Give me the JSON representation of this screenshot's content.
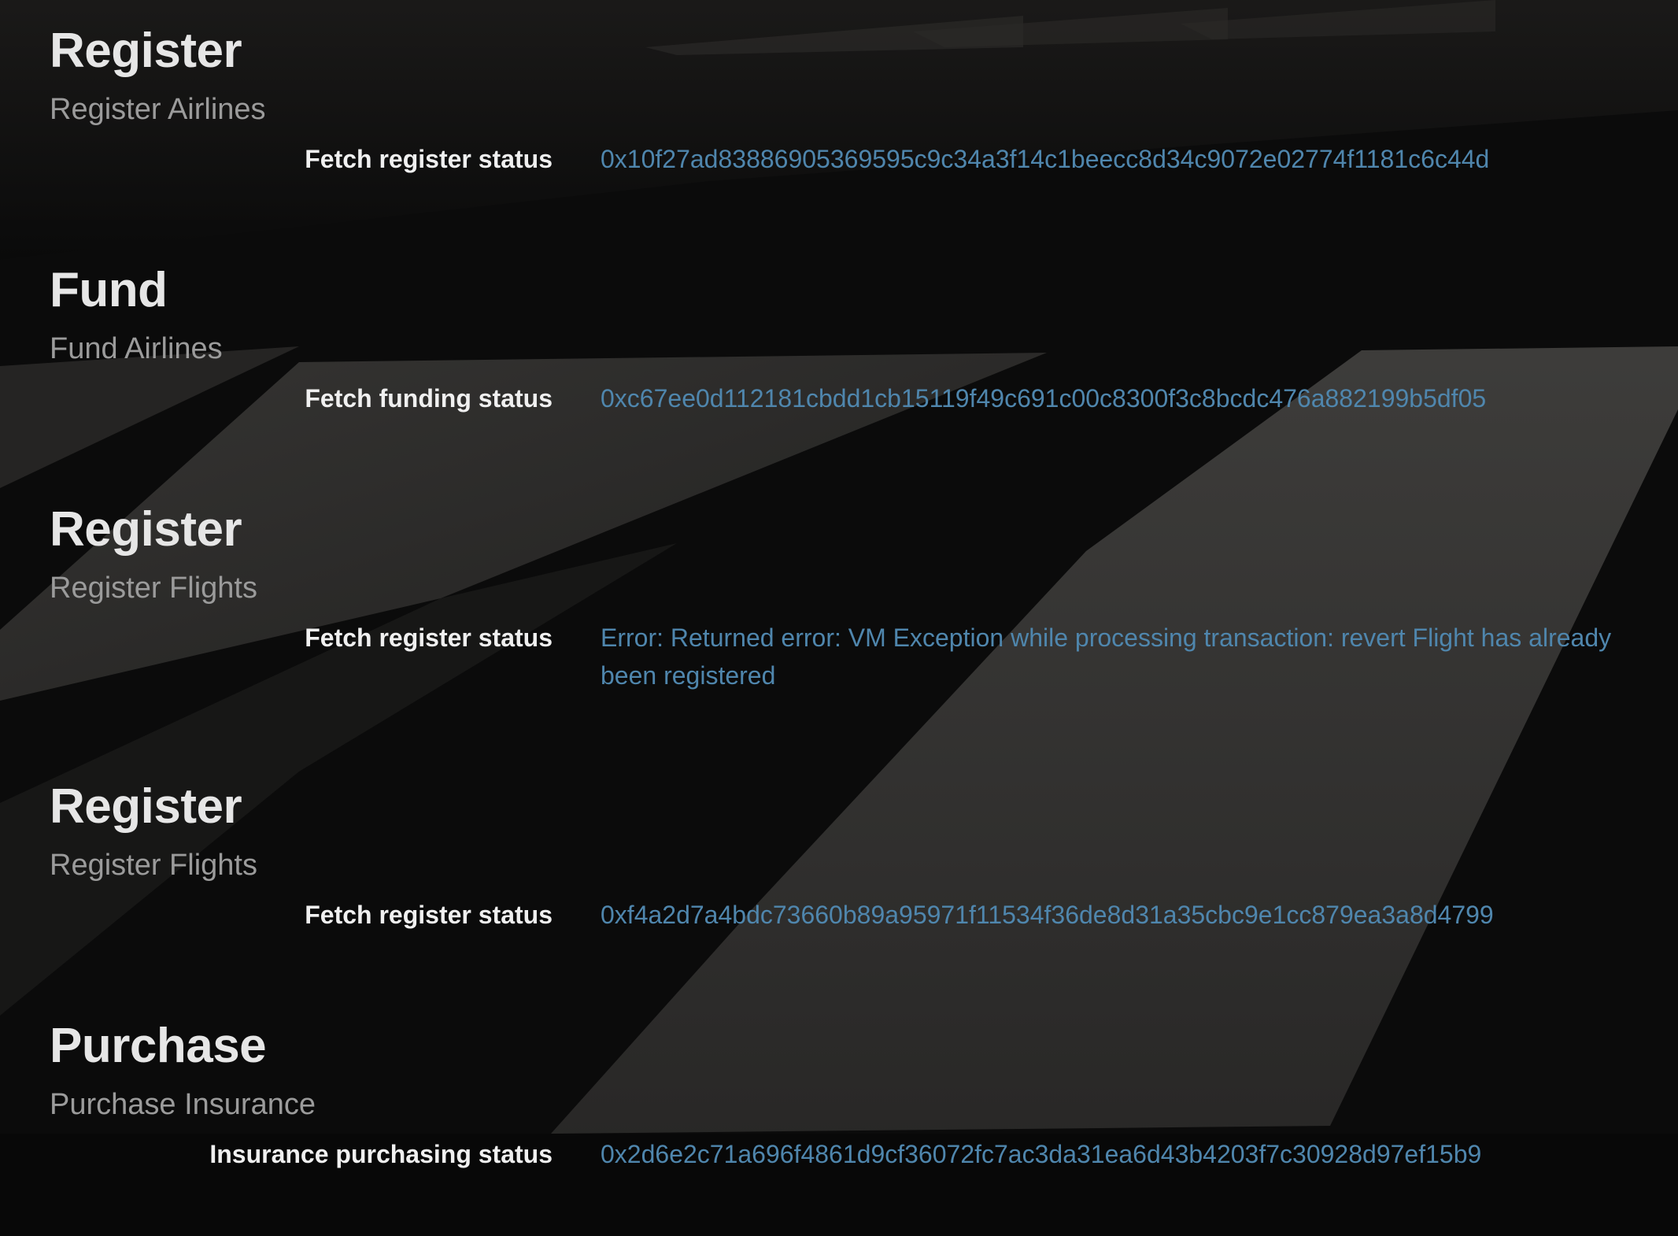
{
  "colors": {
    "background": "#0a0a0a",
    "title": "#e6e6e6",
    "subtitle": "#9b9b9b",
    "label": "#f0f0f0",
    "status_value": "#4f86ad"
  },
  "sections": [
    {
      "title": "Register",
      "subtitle": "Register Airlines",
      "status_label": "Fetch register status",
      "status_value": "0x10f27ad83886905369595c9c34a3f14c1beecc8d34c9072e02774f1181c6c44d"
    },
    {
      "title": "Fund",
      "subtitle": "Fund Airlines",
      "status_label": "Fetch funding status",
      "status_value": "0xc67ee0d112181cbdd1cb15119f49c691c00c8300f3c8bcdc476a882199b5df05"
    },
    {
      "title": "Register",
      "subtitle": "Register Flights",
      "status_label": "Fetch register status",
      "status_value": "Error: Returned error: VM Exception while processing transaction: revert Flight has already been registered"
    },
    {
      "title": "Register",
      "subtitle": "Register Flights",
      "status_label": "Fetch register status",
      "status_value": "0xf4a2d7a4bdc73660b89a95971f11534f36de8d31a35cbc9e1cc879ea3a8d4799"
    },
    {
      "title": "Purchase",
      "subtitle": "Purchase Insurance",
      "status_label": "Insurance purchasing status",
      "status_value": "0x2d6e2c71a696f4861d9cf36072fc7ac3da31ea6d43b4203f7c30928d97ef15b9"
    }
  ]
}
